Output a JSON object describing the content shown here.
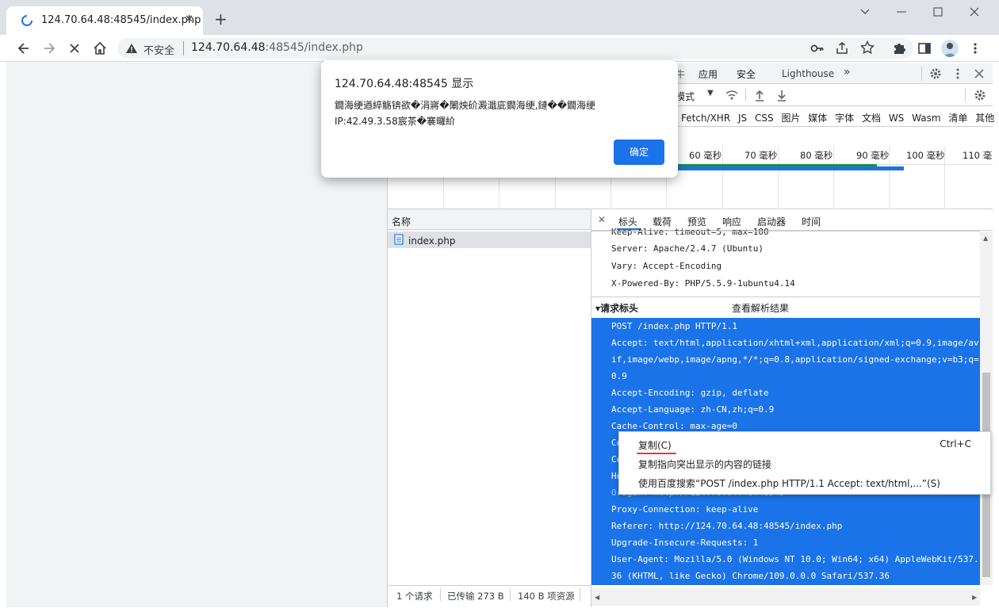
{
  "browser": {
    "tab_title": "124.70.64.48:48545/index.php",
    "tab_close": "✕",
    "new_tab": "+",
    "security_label": "不安全",
    "url_host": "124.70.64.48",
    "url_rest": ":48545/index.php",
    "window_min": "﹀"
  },
  "dialog": {
    "title": "124.70.64.48:48545 显示",
    "message_line1": "鐗海绠遒綷觞锛欲�涓嶈�閳炴砎澱濈庛鐗海绠,鏈��鐗海绠",
    "message_line2": "IP:42.49.3.58宸茶�褰曪紒",
    "ok_label": "确定"
  },
  "devtools": {
    "top_tabs": [
      "应用",
      "安全",
      "Lighthouse"
    ],
    "more_tabs": "»",
    "throttle_label": "模式",
    "filter_types": [
      "Fetch/XHR",
      "JS",
      "CSS",
      "图片",
      "媒体",
      "字体",
      "文档",
      "WS",
      "Wasm",
      "清单",
      "其他"
    ],
    "timeline_ticks": [
      "60 毫秒",
      "70 毫秒",
      "80 毫秒",
      "90 毫秒",
      "100 毫秒",
      "110 毫"
    ],
    "name_header": "名称",
    "request_name": "index.php",
    "detail_tabs": [
      "标头",
      "载荷",
      "预览",
      "响应",
      "启动器",
      "时间"
    ],
    "detail_close": "✕",
    "response_headers": [
      "Keep-Alive: timeout=5, max=100",
      "Server: Apache/2.4.7 (Ubuntu)",
      "Vary: Accept-Encoding",
      "X-Powered-By: PHP/5.5.9-1ubuntu4.14"
    ],
    "request_headers_title": "▾请求标头",
    "view_parsed": "查看解析结果",
    "raw_lines": [
      "POST /index.php HTTP/1.1",
      "Accept: text/html,application/xhtml+xml,application/xml;q=0.9,image/av",
      "if,image/webp,image/apng,*/*;q=0.8,application/signed-exchange;v=b3;q=",
      "0.9",
      "Accept-Encoding: gzip, deflate",
      "Accept-Language: zh-CN,zh;q=0.9",
      "Cache-Control: max-age=0",
      "Co",
      "Co",
      "Ho",
      "Origin: http://124.70.64.48:48545",
      "Proxy-Connection: keep-alive",
      "Referer: http://124.70.64.48:48545/index.php",
      "Upgrade-Insecure-Requests: 1",
      "User-Agent: Mozilla/5.0 (Windows NT 10.0; Win64; x64) AppleWebKit/537.",
      "36 (KHTML, like Gecko) Chrome/109.0.0.0 Safari/537.36"
    ],
    "status": [
      "1 个请求",
      "已传输 273 B",
      "140 B 项资源"
    ]
  },
  "context_menu": {
    "copy": "复制(C)",
    "copy_shortcut": "Ctrl+C",
    "copy_link": "复制指向突出显示的内容的链接",
    "search": "使用百度搜索“POST /index.php HTTP/1.1  Accept: text/html,...”(S)"
  },
  "colors": {
    "accent": "#1a73e8",
    "tabstrip": "#dee1e6"
  }
}
